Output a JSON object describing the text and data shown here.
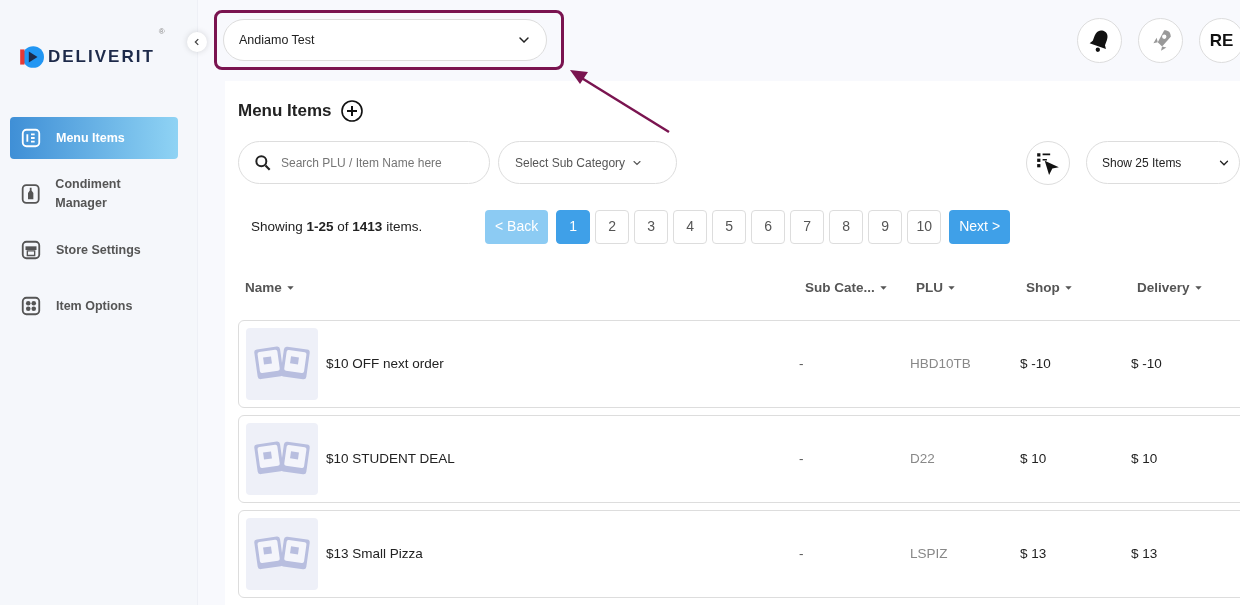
{
  "brand": {
    "name": "DELIVERIT",
    "mark": "®"
  },
  "sidebar": {
    "items": [
      {
        "label": "Menu Items",
        "selected": true
      },
      {
        "label": "Condiment Manager",
        "selected": false
      },
      {
        "label": "Store Settings",
        "selected": false
      },
      {
        "label": "Item Options",
        "selected": false
      }
    ]
  },
  "store_select": {
    "value": "Andiamo Test"
  },
  "header": {
    "avatar": "RE"
  },
  "page_title": "Menu Items",
  "search": {
    "placeholder": "Search PLU / Item Name here"
  },
  "sub_category_select": {
    "value": "Select Sub Category"
  },
  "page_size_select": {
    "value": "Show 25 Items"
  },
  "summary": "Showing **1-25** of **1413** items.",
  "pagination": {
    "back": "< Back",
    "back_disabled": true,
    "next": "Next >",
    "pages": [
      {
        "label": "1",
        "selected": true
      },
      {
        "label": "2",
        "selected": false
      },
      {
        "label": "3",
        "selected": false
      },
      {
        "label": "4",
        "selected": false
      },
      {
        "label": "5",
        "selected": false
      },
      {
        "label": "6",
        "selected": false
      },
      {
        "label": "7",
        "selected": false
      },
      {
        "label": "8",
        "selected": false
      },
      {
        "label": "9",
        "selected": false
      },
      {
        "label": "10",
        "selected": false
      }
    ]
  },
  "table": {
    "columns": [
      "Name",
      "Sub Cate...",
      "PLU",
      "Shop",
      "Delivery"
    ],
    "rows": [
      {
        "name": "$10 OFF next order",
        "sub_category": "-",
        "plu": "HBD10TB",
        "shop": "$ -10",
        "delivery": "$ -10"
      },
      {
        "name": "$10 STUDENT DEAL",
        "sub_category": "-",
        "plu": "D22",
        "shop": "$ 10",
        "delivery": "$ 10"
      },
      {
        "name": "$13 Small Pizza",
        "sub_category": "-",
        "plu": "LSPIZ",
        "shop": "$ 13",
        "delivery": "$ 13"
      }
    ]
  }
}
